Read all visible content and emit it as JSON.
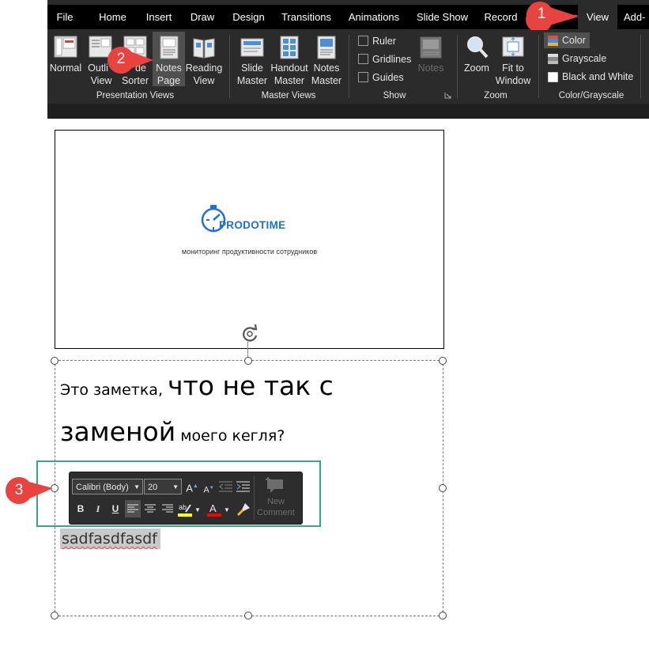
{
  "tabs": [
    "File",
    "Home",
    "Insert",
    "Draw",
    "Design",
    "Transitions",
    "Animations",
    "Slide Show",
    "Record",
    "View",
    "Add-"
  ],
  "active_tab": "View",
  "ribbon": {
    "presentation_views": {
      "group_label": "Presentation Views",
      "normal": "Normal",
      "outline_top": "Outli",
      "outline_bottom": "View",
      "sorter_top": "de",
      "sorter_bottom": "Sorter",
      "notes_page_top": "Notes",
      "notes_page_bottom": "Page",
      "reading_top": "Reading",
      "reading_bottom": "View"
    },
    "master_views": {
      "group_label": "Master Views",
      "slide_top": "Slide",
      "slide_bottom": "Master",
      "handout_top": "Handout",
      "handout_bottom": "Master",
      "notes_top": "Notes",
      "notes_bottom": "Master"
    },
    "show": {
      "group_label": "Show",
      "ruler": "Ruler",
      "gridlines": "Gridlines",
      "guides": "Guides",
      "notes": "Notes"
    },
    "zoom": {
      "group_label": "Zoom",
      "zoom": "Zoom",
      "fit_top": "Fit to",
      "fit_bottom": "Window"
    },
    "color_grayscale": {
      "group_label": "Color/Grayscale",
      "color": "Color",
      "grayscale": "Grayscale",
      "bw": "Black and White"
    }
  },
  "callouts": [
    "1",
    "2",
    "3"
  ],
  "slide": {
    "logo": "PRODOTIME",
    "tagline": "мониторинг продуктивности сотрудников"
  },
  "notes": {
    "part1_small": "Это заметка, ",
    "part2_big": "что не так с заменой",
    "part3_small": " моего кегля?",
    "selected_text": "sadfasdfasdf"
  },
  "mini_toolbar": {
    "font": "Calibri (Body)",
    "size": "20",
    "bold": "B",
    "italic": "I",
    "underline": "U",
    "new_top": "New",
    "new_bottom": "Comment"
  },
  "colors": {
    "ribbon_bg": "#2b2b2b",
    "tabbar_bg": "#000000",
    "callout_red": "#e8433f",
    "highlight_frame": "#3aa67a",
    "highlight_yellow": "#ffff00",
    "font_red": "#ff0000",
    "logo_blue": "#1e6fd9"
  }
}
